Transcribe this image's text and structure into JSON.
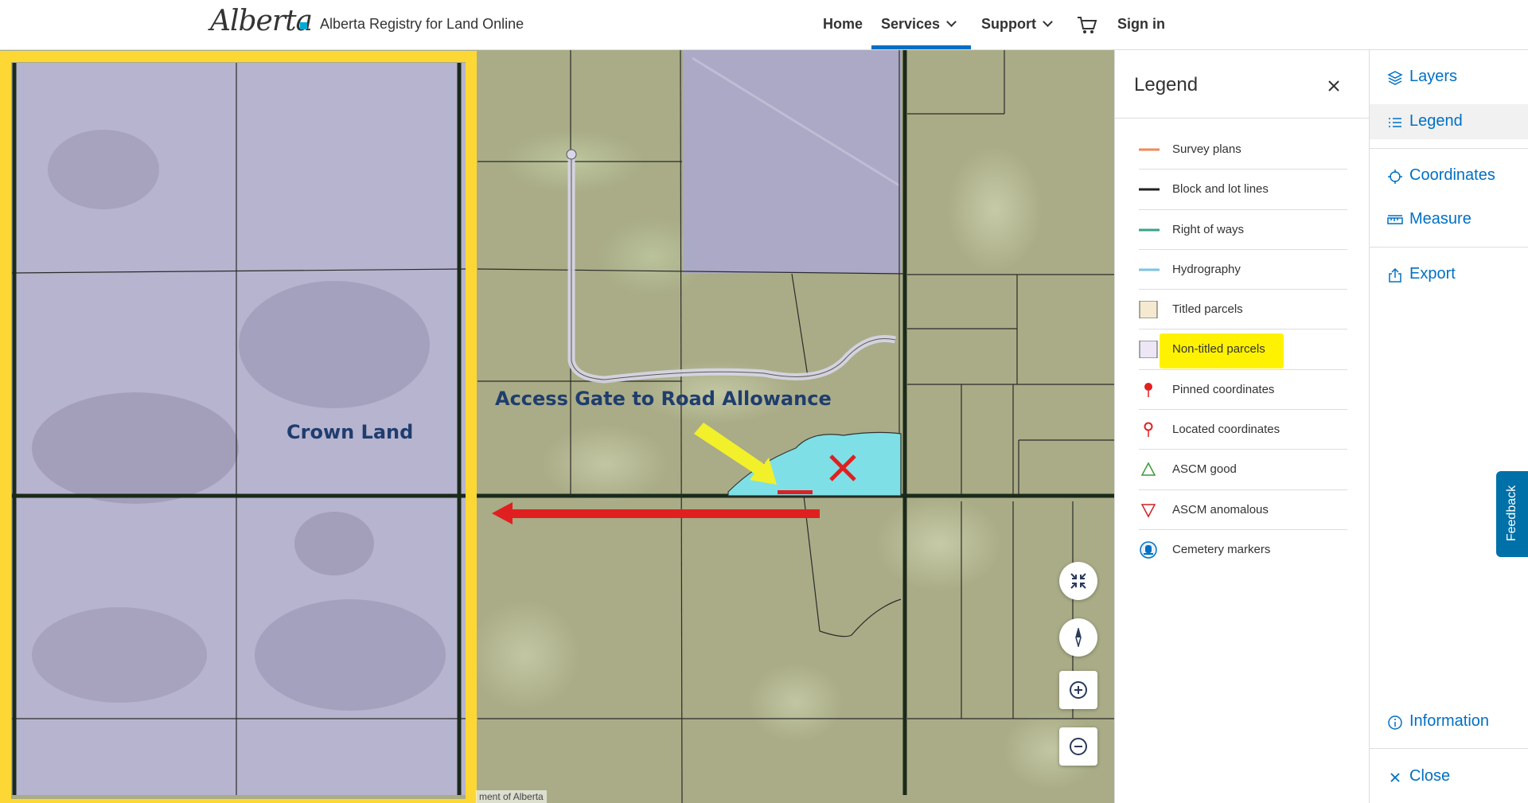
{
  "header": {
    "logo_text": "Alberta",
    "site_title": "Alberta Registry for Land Online",
    "nav": {
      "home": "Home",
      "services": "Services",
      "support": "Support",
      "sign_in": "Sign in"
    }
  },
  "map": {
    "annotations": {
      "crown_land": "Crown Land",
      "access_gate": "Access Gate to Road Allowance"
    },
    "attribution": "ment of Alberta"
  },
  "legend": {
    "title": "Legend",
    "items": [
      {
        "label": "Survey plans",
        "symbol": "line",
        "color": "#f28a5a"
      },
      {
        "label": "Block and lot lines",
        "symbol": "line",
        "color": "#222222"
      },
      {
        "label": "Right of ways",
        "symbol": "line",
        "color": "#3aa18a"
      },
      {
        "label": "Hydrography",
        "symbol": "line",
        "color": "#7ec3e6"
      },
      {
        "label": "Titled parcels",
        "symbol": "box",
        "color": "#f5ead0"
      },
      {
        "label": "Non-titled parcels",
        "symbol": "box",
        "color": "#ece6f5"
      },
      {
        "label": "Pinned coordinates",
        "symbol": "pin",
        "color": "#e02020"
      },
      {
        "label": "Located coordinates",
        "symbol": "pin-outline",
        "color": "#e02020"
      },
      {
        "label": "ASCM good",
        "symbol": "triangle-up",
        "color": "#3a9a3a"
      },
      {
        "label": "ASCM anomalous",
        "symbol": "triangle-down",
        "color": "#d02020"
      },
      {
        "label": "Cemetery markers",
        "symbol": "cemetery",
        "color": "#0070c4"
      }
    ]
  },
  "toolbar": {
    "layers": "Layers",
    "legend": "Legend",
    "coordinates": "Coordinates",
    "measure": "Measure",
    "export": "Export",
    "information": "Information",
    "close": "Close",
    "feedback": "Feedback"
  },
  "colors": {
    "accent": "#0070c4",
    "highlight_yellow": "#fdd835",
    "arrow_red": "#e02020",
    "water": "#7ee0e6"
  }
}
